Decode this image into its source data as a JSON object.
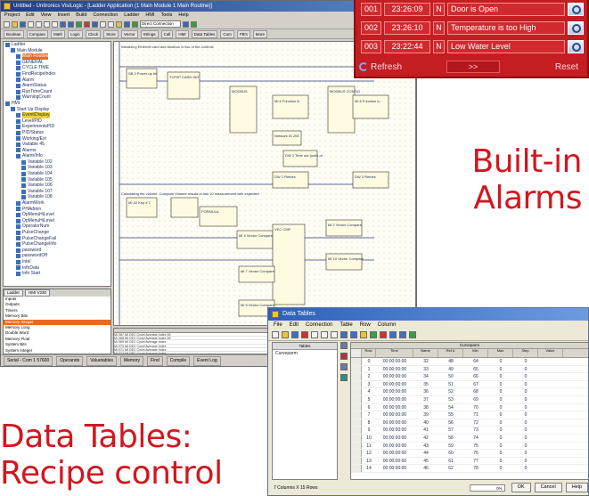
{
  "ide": {
    "title": "Untitled - Unitronics VisiLogic - [Ladder Application (1 Main Module 1 Main Routine)]",
    "menu": [
      "Project",
      "Edit",
      "View",
      "Insert",
      "Build",
      "Connection",
      "Ladder",
      "HMI",
      "Tools",
      "Help"
    ],
    "connection_label": "Direct Connection",
    "toolbar2": [
      "Boolean",
      "Compare",
      "Math",
      "Logic",
      "Clock",
      "Store",
      "Vector",
      "Strings",
      "Call",
      "HMI",
      "Data Tables",
      "Com",
      "FB's",
      "More"
    ],
    "tree": [
      {
        "label": "Ladder",
        "level": 0,
        "hl": ""
      },
      {
        "label": "Main Module",
        "level": 1,
        "hl": ""
      },
      {
        "label": "Main Routine",
        "level": 2,
        "hl": "orange"
      },
      {
        "label": "GENERAL",
        "level": 2,
        "hl": ""
      },
      {
        "label": "CYCLE TIME",
        "level": 2,
        "hl": ""
      },
      {
        "label": "FindRecipeIndex",
        "level": 2,
        "hl": ""
      },
      {
        "label": "Alarm",
        "level": 2,
        "hl": ""
      },
      {
        "label": "AlarmStatus",
        "level": 2,
        "hl": ""
      },
      {
        "label": "RunTimeCount",
        "level": 2,
        "hl": ""
      },
      {
        "label": "WarningCount",
        "level": 2,
        "hl": ""
      },
      {
        "label": "HMI",
        "level": 0,
        "hl": ""
      },
      {
        "label": "Start Up Display",
        "level": 1,
        "hl": ""
      },
      {
        "label": "Event/Display",
        "level": 2,
        "hl": "yellow"
      },
      {
        "label": "Level/PID",
        "level": 2,
        "hl": ""
      },
      {
        "label": "ExperimentsPID",
        "level": 2,
        "hl": ""
      },
      {
        "label": "PID/Status",
        "level": 2,
        "hl": ""
      },
      {
        "label": "Working/Ext",
        "level": 2,
        "hl": ""
      },
      {
        "label": "Variable 45",
        "level": 2,
        "hl": ""
      },
      {
        "label": "Alarms",
        "level": 2,
        "hl": ""
      },
      {
        "label": "Alarm/Info",
        "level": 2,
        "hl": ""
      },
      {
        "label": "Variable 102",
        "level": 3,
        "hl": ""
      },
      {
        "label": "Variable 103",
        "level": 3,
        "hl": ""
      },
      {
        "label": "Variable 104",
        "level": 3,
        "hl": ""
      },
      {
        "label": "Variable 105",
        "level": 3,
        "hl": ""
      },
      {
        "label": "Variable 106",
        "level": 3,
        "hl": ""
      },
      {
        "label": "Variable 107",
        "level": 3,
        "hl": ""
      },
      {
        "label": "Variable 108",
        "level": 3,
        "hl": ""
      },
      {
        "label": "AlarmWork",
        "level": 2,
        "hl": ""
      },
      {
        "label": "PHAdmin",
        "level": 2,
        "hl": ""
      },
      {
        "label": "OpMenuHiLevel",
        "level": 2,
        "hl": ""
      },
      {
        "label": "OpMenuHiLevel",
        "level": 2,
        "hl": ""
      },
      {
        "label": "OperatorNum",
        "level": 2,
        "hl": ""
      },
      {
        "label": "PulseChange",
        "level": 2,
        "hl": ""
      },
      {
        "label": "PulseChangeFail",
        "level": 2,
        "hl": ""
      },
      {
        "label": "PulseChangeInfo",
        "level": 2,
        "hl": ""
      },
      {
        "label": "password",
        "level": 2,
        "hl": ""
      },
      {
        "label": "passwordOff",
        "level": 2,
        "hl": ""
      },
      {
        "label": "Intel",
        "level": 2,
        "hl": ""
      },
      {
        "label": "InfoData",
        "level": 2,
        "hl": ""
      },
      {
        "label": "Info Start",
        "level": 2,
        "hl": ""
      }
    ],
    "var_tabs": [
      "Ladder",
      "HMI V230"
    ],
    "variables": [
      {
        "label": "Inputs",
        "hl": false
      },
      {
        "label": "Outputs",
        "hl": false
      },
      {
        "label": "Timers",
        "hl": false
      },
      {
        "label": "Memory Bits",
        "hl": false
      },
      {
        "label": "Memory Integer",
        "hl": true
      },
      {
        "label": "Memory Long",
        "hl": false
      },
      {
        "label": "Double Word",
        "hl": false
      },
      {
        "label": "Memory Float",
        "hl": false
      },
      {
        "label": "System Bits",
        "hl": false
      },
      {
        "label": "System Integer",
        "hl": false
      }
    ],
    "ladder_note_1": "Initializing Ethernet card and Modbus in two of the controls",
    "ladder_note_2": "Calculating the volume. Compare Volume results in last 10 measurement with expected",
    "blocks": [
      "SB 2 Power-up bit",
      "TCP/IP CARD INIT",
      "MODBUS",
      "MODBUS CONFIG",
      "MI 6 Function in",
      "Socket 2 Default TCP 20000",
      "Network ID 205",
      "DW 2 Time out (units of",
      "MODBUS",
      "MI 6 Function in",
      "Network ID 205",
      "DW 100 Time out (units of",
      "DW 2 Retries",
      "DW 3 Retries",
      "MI 42 Kep # 2",
      "FORMULA",
      "MI 4 Vector Compare",
      "MI 3 Vector Compare",
      "VEC CMP",
      "MI 2 Vector Compare",
      "MI 10 Vector Compare",
      "MI 7 Vector Compare",
      "MI 9 Vector Compare"
    ],
    "status_items": [
      "Serial - Com 1 57600",
      "Operands",
      "Valuetables",
      "Memory",
      "Find",
      "Compile",
      "Event Log"
    ],
    "grid_rows": [
      "MI  067  MI  DEC  Cycel Average Index MI",
      "MI  068  MI  DEC  Cycel Average Index MI",
      "MI  069  MI  DEC  Cycel Average Index",
      "MI  070  MI  DEC  Cycel Average Index",
      "MI  071  MI  DEC  Cycel Average Index",
      "MI  072  MI  DEC  Cycel Average Index"
    ]
  },
  "alarm": {
    "rows": [
      {
        "id": "001",
        "time": "23:26:09",
        "flag": "N",
        "message": "Door is Open"
      },
      {
        "id": "002",
        "time": "23:26:10",
        "flag": "N",
        "message": "Temperature is too High"
      },
      {
        "id": "003",
        "time": "23:22:44",
        "flag": "N",
        "message": "Low Water Level"
      }
    ],
    "refresh_label": "Refresh",
    "next_label": ">>",
    "reset_label": "Reset"
  },
  "headlines": {
    "alarms_line1": "Built-in",
    "alarms_line2": "Alarms",
    "tables_line1": "Data Tables:",
    "tables_line2": "Recipe control"
  },
  "datatables": {
    "title": "Data Tables",
    "menu": [
      "File",
      "Edit",
      "Connection",
      "Table",
      "Row",
      "Column"
    ],
    "left_header": "Tables",
    "left_selected": "Curveparm",
    "section_header": "Curveparm",
    "columns": [
      "Row",
      "Time",
      "Name",
      "Ref #",
      "Min",
      "Max",
      "Step",
      "Value"
    ],
    "rows": [
      [
        "0",
        "00:00:00:00",
        "32",
        "48",
        "64",
        "0",
        "0"
      ],
      [
        "1",
        "00:00:00:00",
        "33",
        "49",
        "65",
        "0",
        "0"
      ],
      [
        "2",
        "00:00:00:00",
        "34",
        "50",
        "66",
        "0",
        "0"
      ],
      [
        "3",
        "00:00:00:00",
        "35",
        "51",
        "67",
        "0",
        "0"
      ],
      [
        "4",
        "00:00:00:00",
        "36",
        "52",
        "68",
        "0",
        "0"
      ],
      [
        "5",
        "00:00:00:00",
        "37",
        "53",
        "69",
        "0",
        "0"
      ],
      [
        "6",
        "00:00:00:00",
        "38",
        "54",
        "70",
        "0",
        "0"
      ],
      [
        "7",
        "00:00:00:00",
        "39",
        "55",
        "71",
        "0",
        "0"
      ],
      [
        "8",
        "00:00:00:00",
        "40",
        "56",
        "72",
        "0",
        "0"
      ],
      [
        "9",
        "00:00:00:00",
        "41",
        "57",
        "73",
        "0",
        "0"
      ],
      [
        "10",
        "00:00:00:00",
        "42",
        "58",
        "74",
        "0",
        "0"
      ],
      [
        "11",
        "00:00:00:00",
        "43",
        "59",
        "75",
        "0",
        "0"
      ],
      [
        "12",
        "00:00:00:00",
        "44",
        "60",
        "76",
        "0",
        "0"
      ],
      [
        "13",
        "00:00:00:00",
        "45",
        "61",
        "77",
        "0",
        "0"
      ],
      [
        "14",
        "00:00:00:00",
        "46",
        "62",
        "78",
        "0",
        "0"
      ]
    ],
    "status": "7 Columns X 15 Rows",
    "zoom": "0%",
    "ok_label": "OK",
    "cancel_label": "Cancel",
    "help_label": "Help"
  },
  "colors": {
    "brand_red": "#d3161e",
    "alarm_bg": "#c41d22",
    "highlight_orange": "#e96a1f",
    "highlight_yellow": "#f0d030"
  }
}
